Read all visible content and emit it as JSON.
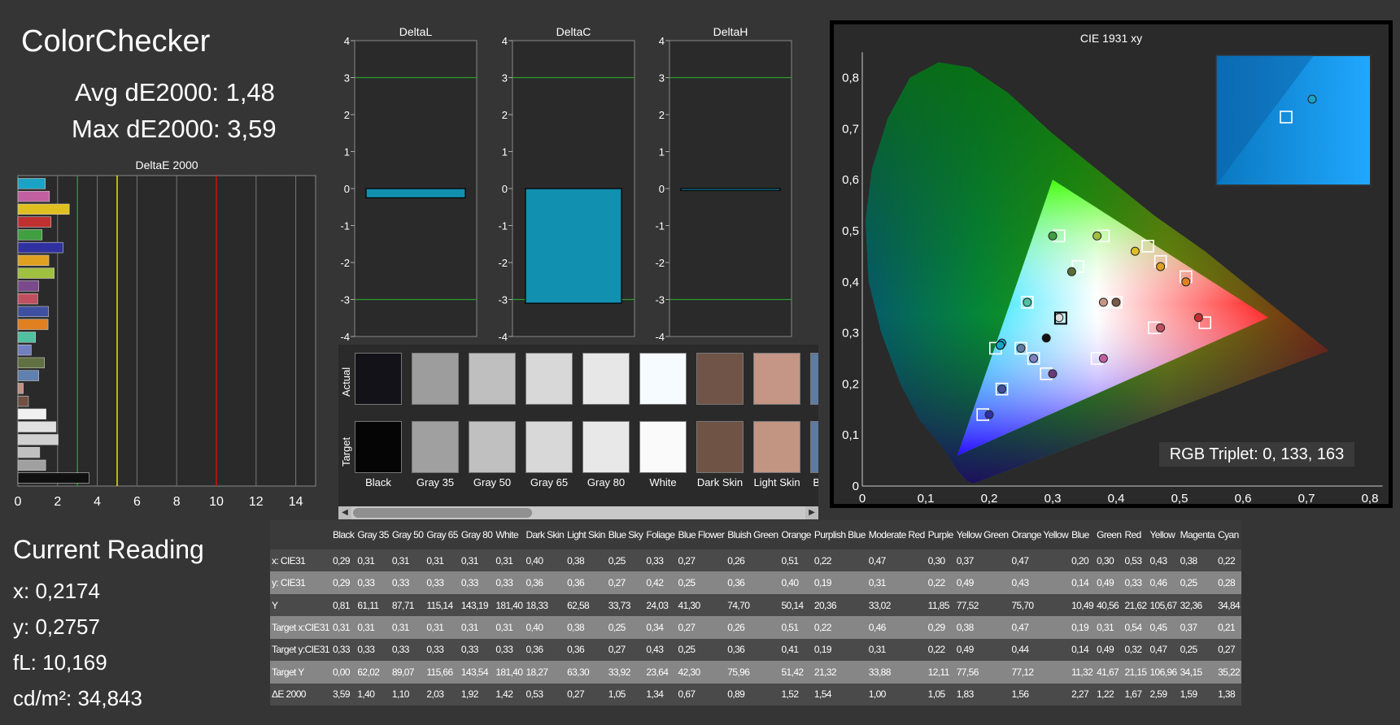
{
  "header": {
    "title": "ColorChecker",
    "avg": "Avg dE2000: 1,48",
    "max": "Max dE2000: 3,59"
  },
  "current_reading": {
    "title": "Current Reading",
    "x": "x: 0,2174",
    "y": "y: 0,2757",
    "fl": "fL: 10,169",
    "cd": "cd/m²: 34,843"
  },
  "rgb_triplet": "RGB Triplet: 0, 133, 163",
  "swatch_labels": {
    "actual": "Actual",
    "target": "Target"
  },
  "swatches": [
    {
      "name": "Black",
      "actual": "#121218",
      "target": "#050505"
    },
    {
      "name": "Gray 35",
      "actual": "#9c9d9c",
      "target": "#a0a0a0"
    },
    {
      "name": "Gray 50",
      "actual": "#bebfbe",
      "target": "#c0c0c0"
    },
    {
      "name": "Gray 65",
      "actual": "#d7d8d7",
      "target": "#d8d8d8"
    },
    {
      "name": "Gray 80",
      "actual": "#e6e7e6",
      "target": "#e8e8e8"
    },
    {
      "name": "White",
      "actual": "#f6fbff",
      "target": "#fafafa"
    },
    {
      "name": "Dark Skin",
      "actual": "#705447",
      "target": "#6f5446"
    },
    {
      "name": "Light Skin",
      "actual": "#c59585",
      "target": "#c29582"
    },
    {
      "name": "Blue Sky",
      "actual": "#5e7ca2",
      "target": "#5e7aa0"
    }
  ],
  "table": {
    "headers": [
      "",
      "Black",
      "Gray 35",
      "Gray 50",
      "Gray 65",
      "Gray 80",
      "White",
      "Dark Skin",
      "Light Skin",
      "Blue Sky",
      "Foliage",
      "Blue Flower",
      "Bluish Green",
      "Orange",
      "Purplish Blue",
      "Moderate Red",
      "Purple",
      "Yellow Green",
      "Orange Yellow",
      "Blue",
      "Green",
      "Red",
      "Yellow",
      "Magenta",
      "Cyan"
    ],
    "rows": [
      [
        "x: CIE31",
        "0,29",
        "0,31",
        "0,31",
        "0,31",
        "0,31",
        "0,31",
        "0,40",
        "0,38",
        "0,25",
        "0,33",
        "0,27",
        "0,26",
        "0,51",
        "0,22",
        "0,47",
        "0,30",
        "0,37",
        "0,47",
        "0,20",
        "0,30",
        "0,53",
        "0,43",
        "0,38",
        "0,22"
      ],
      [
        "y: CIE31",
        "0,29",
        "0,33",
        "0,33",
        "0,33",
        "0,33",
        "0,33",
        "0,36",
        "0,36",
        "0,27",
        "0,42",
        "0,25",
        "0,36",
        "0,40",
        "0,19",
        "0,31",
        "0,22",
        "0,49",
        "0,43",
        "0,14",
        "0,49",
        "0,33",
        "0,46",
        "0,25",
        "0,28"
      ],
      [
        "Y",
        "0,81",
        "61,11",
        "87,71",
        "115,14",
        "143,19",
        "181,40",
        "18,33",
        "62,58",
        "33,73",
        "24,03",
        "41,30",
        "74,70",
        "50,14",
        "20,36",
        "33,02",
        "11,85",
        "77,52",
        "75,70",
        "10,49",
        "40,56",
        "21,62",
        "105,67",
        "32,36",
        "34,84"
      ],
      [
        "Target x:CIE31",
        "0,31",
        "0,31",
        "0,31",
        "0,31",
        "0,31",
        "0,31",
        "0,40",
        "0,38",
        "0,25",
        "0,34",
        "0,27",
        "0,26",
        "0,51",
        "0,22",
        "0,46",
        "0,29",
        "0,38",
        "0,47",
        "0,19",
        "0,31",
        "0,54",
        "0,45",
        "0,37",
        "0,21"
      ],
      [
        "Target y:CIE31",
        "0,33",
        "0,33",
        "0,33",
        "0,33",
        "0,33",
        "0,33",
        "0,36",
        "0,36",
        "0,27",
        "0,43",
        "0,25",
        "0,36",
        "0,41",
        "0,19",
        "0,31",
        "0,22",
        "0,49",
        "0,44",
        "0,14",
        "0,49",
        "0,32",
        "0,47",
        "0,25",
        "0,27"
      ],
      [
        "Target Y",
        "0,00",
        "62,02",
        "89,07",
        "115,66",
        "143,54",
        "181,40",
        "18,27",
        "63,30",
        "33,92",
        "23,64",
        "42,30",
        "75,96",
        "51,42",
        "21,32",
        "33,88",
        "12,11",
        "77,56",
        "77,12",
        "11,32",
        "41,67",
        "21,15",
        "106,96",
        "34,15",
        "35,22"
      ],
      [
        "ΔE 2000",
        "3,59",
        "1,40",
        "1,10",
        "2,03",
        "1,92",
        "1,42",
        "0,53",
        "0,27",
        "1,05",
        "1,34",
        "0,67",
        "0,89",
        "1,52",
        "1,54",
        "1,00",
        "1,05",
        "1,83",
        "1,56",
        "2,27",
        "1,22",
        "1,67",
        "2,59",
        "1,59",
        "1,38"
      ]
    ]
  },
  "chart_data": [
    {
      "type": "bar",
      "title": "DeltaE 2000",
      "orientation": "horizontal",
      "xlim": [
        0,
        15
      ],
      "xticks": [
        "0",
        "2",
        "4",
        "6",
        "8",
        "10",
        "12",
        "14"
      ],
      "threshold_lines": [
        {
          "value": 3,
          "color": "#1f9a1f"
        },
        {
          "value": 5,
          "color": "#e8e800"
        },
        {
          "value": 10,
          "color": "#d01010"
        }
      ],
      "bars": [
        {
          "value": 1.38,
          "color": "#1aa3c4"
        },
        {
          "value": 1.59,
          "color": "#c060a0"
        },
        {
          "value": 2.59,
          "color": "#e0c020"
        },
        {
          "value": 1.67,
          "color": "#c03030"
        },
        {
          "value": 1.22,
          "color": "#40a040"
        },
        {
          "value": 2.27,
          "color": "#3030a0"
        },
        {
          "value": 1.56,
          "color": "#e0a020"
        },
        {
          "value": 1.83,
          "color": "#a0c040"
        },
        {
          "value": 1.05,
          "color": "#7a4a8c"
        },
        {
          "value": 1.0,
          "color": "#c05060"
        },
        {
          "value": 1.54,
          "color": "#4050a0"
        },
        {
          "value": 1.52,
          "color": "#e08020"
        },
        {
          "value": 0.89,
          "color": "#50c0a0"
        },
        {
          "value": 0.67,
          "color": "#7080c0"
        },
        {
          "value": 1.34,
          "color": "#607040"
        },
        {
          "value": 1.05,
          "color": "#6080b0"
        },
        {
          "value": 0.27,
          "color": "#c09080"
        },
        {
          "value": 0.53,
          "color": "#705040"
        },
        {
          "value": 1.42,
          "color": "#f0f0f0"
        },
        {
          "value": 1.92,
          "color": "#e0e0e0"
        },
        {
          "value": 2.03,
          "color": "#d0d0d0"
        },
        {
          "value": 1.1,
          "color": "#c0c0c0"
        },
        {
          "value": 1.4,
          "color": "#a0a0a0"
        },
        {
          "value": 3.59,
          "color": "#101010"
        }
      ]
    },
    {
      "type": "bar",
      "title": "DeltaL",
      "ylim": [
        -4,
        4
      ],
      "yticks": [
        "4",
        "3",
        "2",
        "1",
        "0",
        "-1",
        "-2",
        "-3",
        "-4"
      ],
      "guide_lines": [
        3,
        -3
      ],
      "value": -0.25
    },
    {
      "type": "bar",
      "title": "DeltaC",
      "ylim": [
        -4,
        4
      ],
      "yticks": [
        "4",
        "3",
        "2",
        "1",
        "0",
        "-1",
        "-2",
        "-3",
        "-4"
      ],
      "guide_lines": [
        3,
        -3
      ],
      "value": -3.1
    },
    {
      "type": "bar",
      "title": "DeltaH",
      "ylim": [
        -4,
        4
      ],
      "yticks": [
        "4",
        "3",
        "2",
        "1",
        "0",
        "-1",
        "-2",
        "-3",
        "-4"
      ],
      "guide_lines": [
        3,
        -3
      ],
      "value": -0.05
    },
    {
      "type": "scatter",
      "title": "CIE 1931 xy",
      "xlim": [
        0,
        0.82
      ],
      "ylim": [
        0,
        0.85
      ],
      "xticks": [
        "0",
        "0,1",
        "0,2",
        "0,3",
        "0,4",
        "0,5",
        "0,6",
        "0,7",
        "0,8"
      ],
      "yticks": [
        "0",
        "0,1",
        "0,2",
        "0,3",
        "0,4",
        "0,5",
        "0,6",
        "0,7",
        "0,8"
      ],
      "gamut": {
        "red": [
          0.64,
          0.33
        ],
        "green": [
          0.3,
          0.6
        ],
        "blue": [
          0.15,
          0.06
        ]
      },
      "white_point": [
        0.3127,
        0.329
      ],
      "current": [
        0.2174,
        0.2757
      ],
      "points": [
        {
          "x": 0.29,
          "y": 0.29,
          "tx": 0.3127,
          "ty": 0.329,
          "color": "#111111"
        },
        {
          "x": 0.31,
          "y": 0.33,
          "tx": 0.3127,
          "ty": 0.329,
          "color": "#dddddd"
        },
        {
          "x": 0.4,
          "y": 0.36,
          "tx": 0.4,
          "ty": 0.36,
          "color": "#7a5a4a"
        },
        {
          "x": 0.38,
          "y": 0.36,
          "tx": 0.38,
          "ty": 0.36,
          "color": "#c59585"
        },
        {
          "x": 0.25,
          "y": 0.27,
          "tx": 0.25,
          "ty": 0.27,
          "color": "#5e7ca2"
        },
        {
          "x": 0.33,
          "y": 0.42,
          "tx": 0.34,
          "ty": 0.43,
          "color": "#5a6e3a"
        },
        {
          "x": 0.27,
          "y": 0.25,
          "tx": 0.27,
          "ty": 0.25,
          "color": "#8080c0"
        },
        {
          "x": 0.26,
          "y": 0.36,
          "tx": 0.26,
          "ty": 0.36,
          "color": "#50c0a0"
        },
        {
          "x": 0.51,
          "y": 0.4,
          "tx": 0.51,
          "ty": 0.41,
          "color": "#e08020"
        },
        {
          "x": 0.22,
          "y": 0.19,
          "tx": 0.22,
          "ty": 0.19,
          "color": "#4050a0"
        },
        {
          "x": 0.47,
          "y": 0.31,
          "tx": 0.46,
          "ty": 0.31,
          "color": "#c05060"
        },
        {
          "x": 0.3,
          "y": 0.22,
          "tx": 0.29,
          "ty": 0.22,
          "color": "#6a3a7a"
        },
        {
          "x": 0.37,
          "y": 0.49,
          "tx": 0.38,
          "ty": 0.49,
          "color": "#a0c040"
        },
        {
          "x": 0.47,
          "y": 0.43,
          "tx": 0.47,
          "ty": 0.44,
          "color": "#e0a020"
        },
        {
          "x": 0.2,
          "y": 0.14,
          "tx": 0.19,
          "ty": 0.14,
          "color": "#3030a0"
        },
        {
          "x": 0.3,
          "y": 0.49,
          "tx": 0.31,
          "ty": 0.49,
          "color": "#40a040"
        },
        {
          "x": 0.53,
          "y": 0.33,
          "tx": 0.54,
          "ty": 0.32,
          "color": "#c03030"
        },
        {
          "x": 0.43,
          "y": 0.46,
          "tx": 0.45,
          "ty": 0.47,
          "color": "#e0c020"
        },
        {
          "x": 0.38,
          "y": 0.25,
          "tx": 0.37,
          "ty": 0.25,
          "color": "#c060a0"
        },
        {
          "x": 0.22,
          "y": 0.28,
          "tx": 0.21,
          "ty": 0.27,
          "color": "#1aa3c4"
        }
      ]
    }
  ]
}
